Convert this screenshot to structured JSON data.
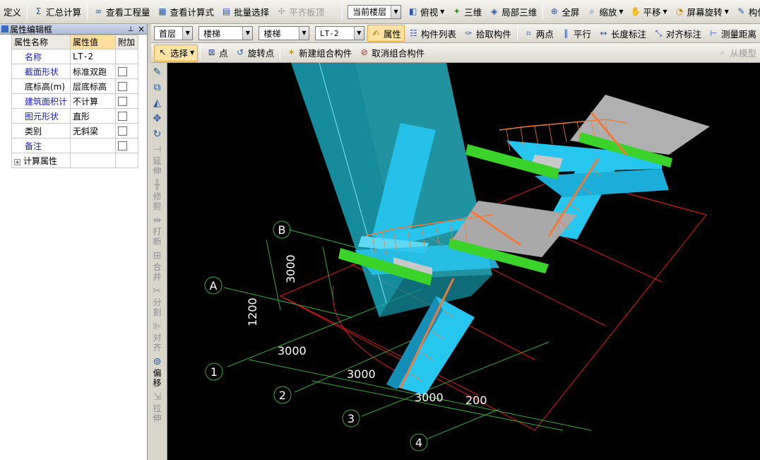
{
  "toolbar_main": {
    "define": "定义",
    "sum_calc": "汇总计算",
    "view_quantity": "查看工程量",
    "view_formula": "查看计算式",
    "batch_select": "批量选择",
    "flush_slab": "平齐板顶",
    "current_floor": "当前楼层",
    "top_view": "俯视",
    "three_d": "三维",
    "local_3d": "局部三维",
    "full_screen": "全屏",
    "zoom": "缩放",
    "pan": "平移",
    "screen_rotate": "屏幕旋转",
    "component_display": "构件图元显"
  },
  "toolbar_second": {
    "floor": "首层",
    "category": "楼梯",
    "type": "楼梯",
    "component": "LT-2",
    "properties": "属性",
    "component_list": "构件列表",
    "pick_component": "拾取构件",
    "two_points": "两点",
    "parallel": "平行",
    "length_dim": "长度标注",
    "align_dim": "对齐标注",
    "measure_distance": "测量距离"
  },
  "toolbar_third": {
    "select": "选择",
    "point": "点",
    "rotate_point": "旋转点",
    "new_group": "新建组合构件",
    "cancel_group": "取消组合构件",
    "from_model": "从模型"
  },
  "panel": {
    "title": "属性编辑框",
    "headers": {
      "name": "属性名称",
      "value": "属性值",
      "extra": "附加"
    },
    "rows": [
      {
        "name": "名称",
        "value": "LT-2",
        "blue": true,
        "check": false
      },
      {
        "name": "截面形状",
        "value": "标准双跑",
        "blue": true,
        "check": true
      },
      {
        "name": "底标高(m)",
        "value": "层底标高",
        "blue": false,
        "check": true
      },
      {
        "name": "建筑面积计",
        "value": "不计算",
        "blue": true,
        "check": true
      },
      {
        "name": "图元形状",
        "value": "直形",
        "blue": true,
        "check": true
      },
      {
        "name": "类别",
        "value": "无斜梁",
        "blue": false,
        "check": true
      },
      {
        "name": "备注",
        "value": "",
        "blue": true,
        "check": true
      }
    ],
    "calc_props": "计算属性"
  },
  "vertical_tools": [
    {
      "label": "",
      "icon": "brush-icon",
      "glyph": "✎",
      "disabled": false
    },
    {
      "label": "",
      "icon": "copy-icon",
      "glyph": "⧉",
      "disabled": false
    },
    {
      "label": "",
      "icon": "mirror-icon",
      "glyph": "◭",
      "disabled": false
    },
    {
      "label": "",
      "icon": "move-icon",
      "glyph": "✥",
      "disabled": false
    },
    {
      "label": "",
      "icon": "rotate-icon",
      "glyph": "↻",
      "disabled": false
    },
    {
      "label": "延伸",
      "icon": "extend-icon",
      "glyph": "⊣",
      "disabled": true
    },
    {
      "label": "修剪",
      "icon": "trim-icon",
      "glyph": "╫",
      "disabled": true
    },
    {
      "label": "打断",
      "icon": "break-icon",
      "glyph": "⇹",
      "disabled": true
    },
    {
      "label": "合并",
      "icon": "merge-icon",
      "glyph": "⊞",
      "disabled": true
    },
    {
      "label": "分割",
      "icon": "split-icon",
      "glyph": "✂",
      "disabled": true
    },
    {
      "label": "对齐",
      "icon": "align-icon",
      "glyph": "⊫",
      "disabled": true
    },
    {
      "label": "偏移",
      "icon": "offset-icon",
      "glyph": "⊚",
      "disabled": false
    },
    {
      "label": "拉伸",
      "icon": "stretch-icon",
      "glyph": "⇲",
      "disabled": true
    }
  ],
  "canvas": {
    "axis_letters": [
      "A",
      "B"
    ],
    "axis_numbers": [
      "1",
      "2",
      "3",
      "4"
    ],
    "dims": {
      "d3000_vertical": "3000",
      "d1200": "1200",
      "d3000_a": "3000",
      "d3000_b": "3000",
      "d3000_c": "3000",
      "d200": "200"
    }
  },
  "colors": {
    "stair": "#27c6ef",
    "stair_dark": "#168fb8",
    "railing": "#f07a3a",
    "beam": "#3bd22a",
    "landing": "#a9a9a9",
    "wall": "#1aa3b7",
    "grid_red": "#e01818",
    "grid_green": "#3fa63f"
  }
}
